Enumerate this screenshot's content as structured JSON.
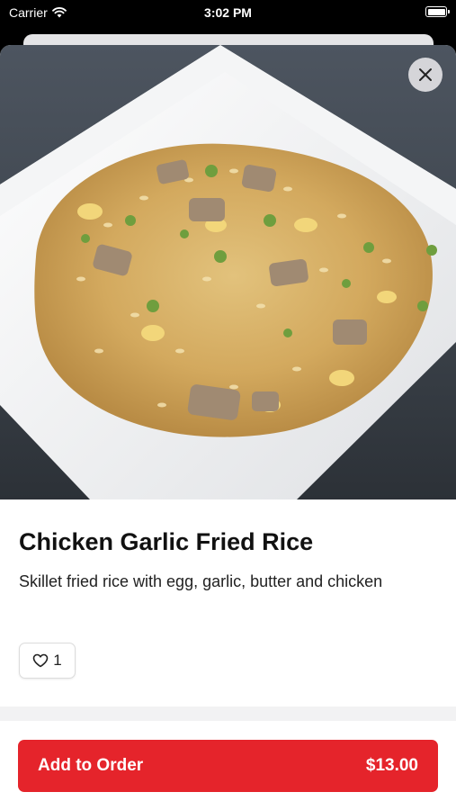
{
  "status_bar": {
    "carrier": "Carrier",
    "time": "3:02 PM"
  },
  "item": {
    "name": "Chicken Garlic Fried Rice",
    "description": "Skillet fried rice with egg, garlic, butter and chicken",
    "like_count": "1"
  },
  "order_button": {
    "label": "Add to Order",
    "price": "$13.00"
  },
  "icons": {
    "close": "close-icon",
    "heart": "heart-icon",
    "wifi": "wifi-icon",
    "battery": "battery-icon"
  },
  "colors": {
    "accent": "#e5242b"
  }
}
